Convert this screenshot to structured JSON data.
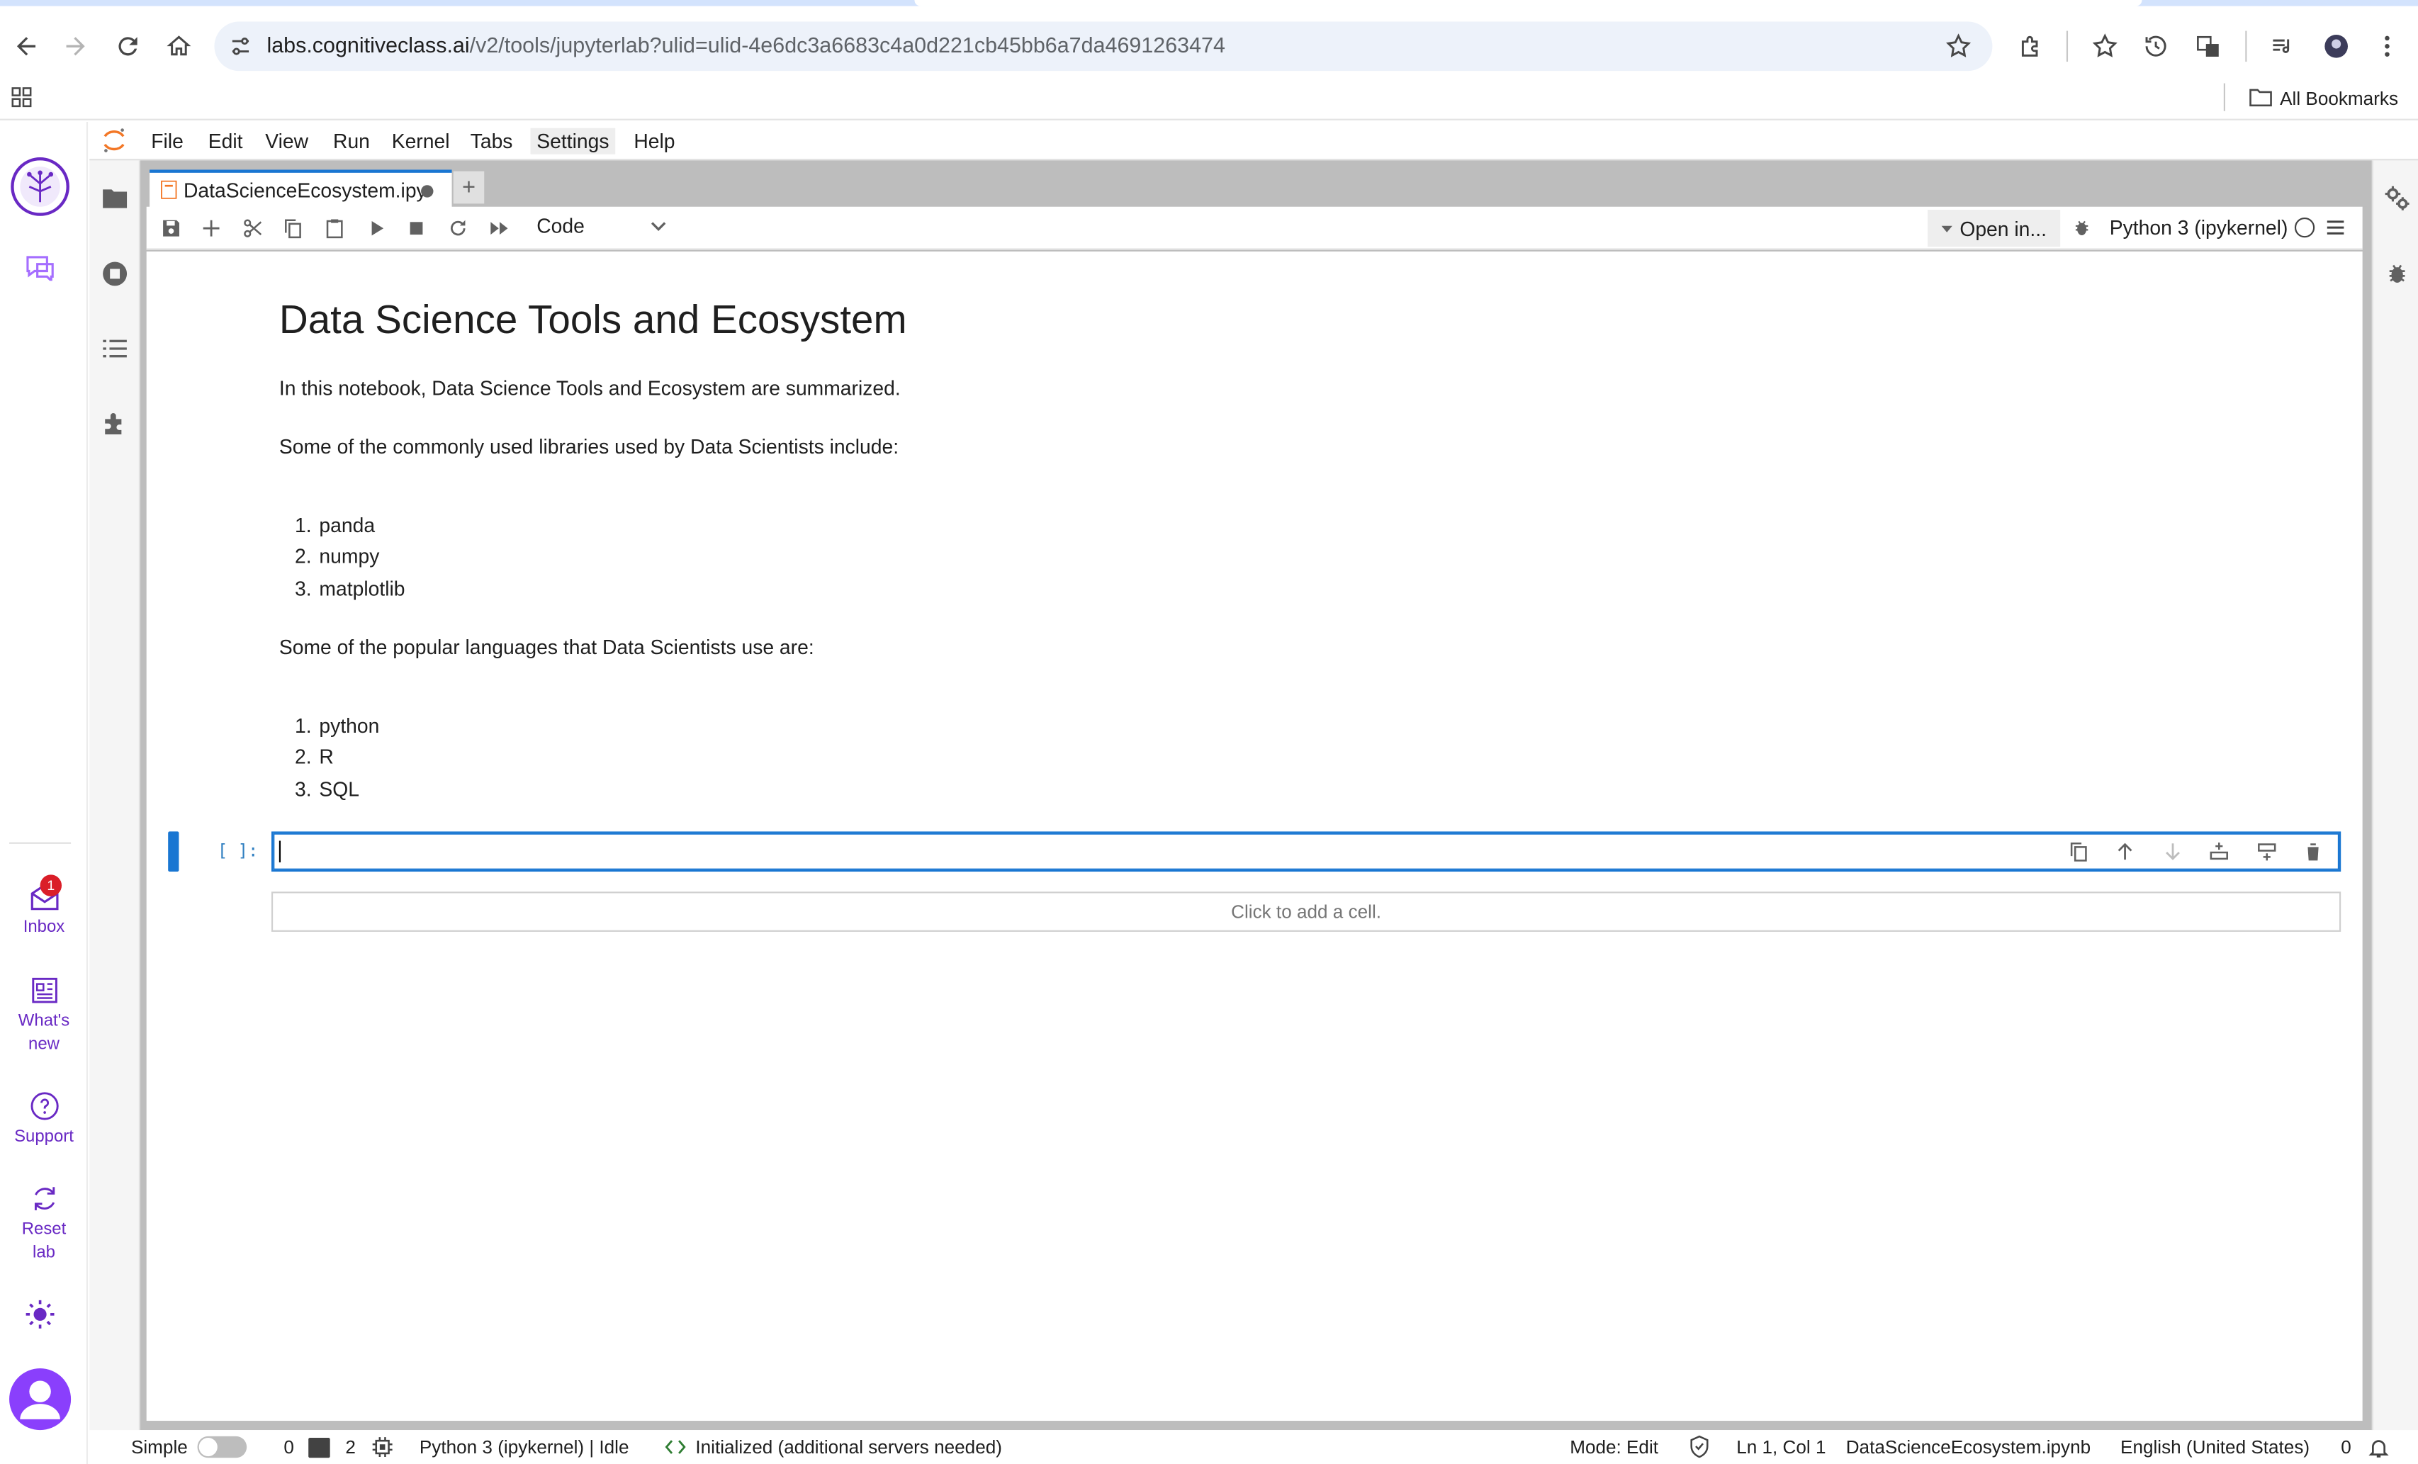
{
  "browser": {
    "url_prefix": "labs.cognitiveclass.ai",
    "url_rest": "/v2/tools/jupyterlab?ulid=ulid-4e6dc3a6683c4a0d221cb45bb6a7da4691263474",
    "all_bookmarks": "All Bookmarks"
  },
  "rail": {
    "inbox_label": "Inbox",
    "inbox_count": "1",
    "whatsnew_label_1": "What's",
    "whatsnew_label_2": "new",
    "support_label": "Support",
    "reset_label_1": "Reset",
    "reset_label_2": "lab",
    "accent_color": "#6929c4"
  },
  "menu": [
    "File",
    "Edit",
    "View",
    "Run",
    "Kernel",
    "Tabs",
    "Settings",
    "Help"
  ],
  "tab": {
    "title": "DataScienceEcosystem.ipy",
    "add": "+"
  },
  "toolbar": {
    "cell_type": "Code",
    "open_in": "Open in...",
    "kernel": "Python 3 (ipykernel)"
  },
  "notebook": {
    "heading": "Data Science Tools and Ecosystem",
    "intro": "In this notebook, Data Science Tools and Ecosystem are summarized.",
    "libraries_intro": "Some of the commonly used libraries used by Data Scientists include:",
    "libraries": [
      "panda",
      "numpy",
      "matplotlib"
    ],
    "languages_intro": "Some of the popular languages that Data Scientists use are:",
    "languages": [
      "python",
      "R",
      "SQL"
    ],
    "code_prompt": "[ ]:",
    "add_cell": "Click to add a cell."
  },
  "statusbar": {
    "mode": "Simple",
    "terminals": "0",
    "kernels": "2",
    "kernel_status": "Python 3 (ipykernel) | Idle",
    "lsp": "Initialized (additional servers needed)",
    "edit_mode": "Mode: Edit",
    "position": "Ln 1, Col 1",
    "filename": "DataScienceEcosystem.ipynb",
    "language": "English (United States)",
    "notifications": "0"
  }
}
